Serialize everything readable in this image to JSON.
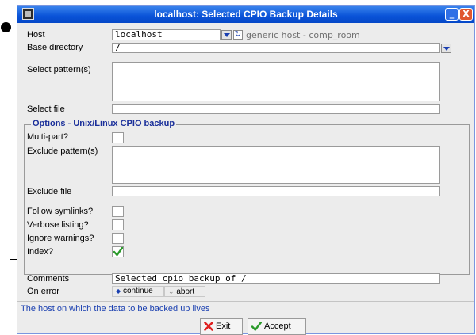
{
  "window": {
    "title": "localhost: Selected CPIO Backup Details",
    "minimize_symbol": "_",
    "close_symbol": "X"
  },
  "form": {
    "host": {
      "label": "Host",
      "value": "localhost",
      "hint": "generic host - comp_room"
    },
    "base_directory": {
      "label": "Base directory",
      "value": "/"
    },
    "select_patterns": {
      "label": "Select pattern(s)",
      "value": ""
    },
    "select_file": {
      "label": "Select file",
      "value": ""
    }
  },
  "options": {
    "title": "Options - Unix/Linux CPIO backup",
    "multi_part": {
      "label": "Multi-part?",
      "checked": false
    },
    "exclude_patterns": {
      "label": "Exclude pattern(s)",
      "value": ""
    },
    "exclude_file": {
      "label": "Exclude file",
      "value": ""
    },
    "follow_symlinks": {
      "label": "Follow symlinks?",
      "checked": false
    },
    "verbose_listing": {
      "label": "Verbose listing?",
      "checked": false
    },
    "ignore_warnings": {
      "label": "Ignore warnings?",
      "checked": false
    },
    "index": {
      "label": "Index?",
      "checked": true
    }
  },
  "comments": {
    "label": "Comments",
    "value": "Selected cpio backup of /"
  },
  "on_error": {
    "label": "On error",
    "options": [
      "continue",
      "abort"
    ],
    "selected": "continue"
  },
  "status_text": "The host on which the data to be backed up lives",
  "buttons": {
    "exit": "Exit",
    "accept": "Accept"
  },
  "colors": {
    "title_bar": "#0a53d8",
    "accent_text": "#1a3fb0",
    "check": "#2a9a2a",
    "exit_icon": "#e02020"
  }
}
